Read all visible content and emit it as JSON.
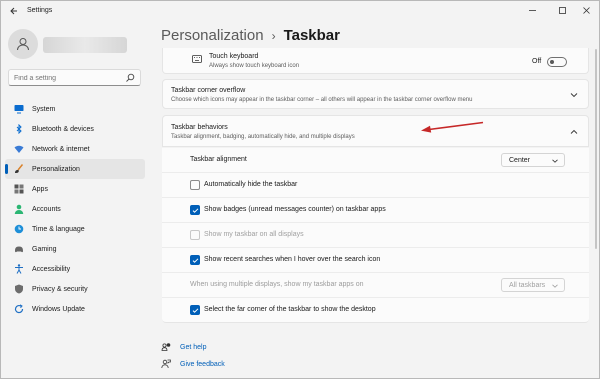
{
  "window": {
    "title": "Settings"
  },
  "sidebar": {
    "search_placeholder": "Find a setting",
    "items": [
      {
        "label": "System",
        "icon": "monitor-icon"
      },
      {
        "label": "Bluetooth & devices",
        "icon": "bluetooth-icon"
      },
      {
        "label": "Network & internet",
        "icon": "wifi-icon"
      },
      {
        "label": "Personalization",
        "icon": "brush-icon",
        "active": true
      },
      {
        "label": "Apps",
        "icon": "apps-icon"
      },
      {
        "label": "Accounts",
        "icon": "person-icon"
      },
      {
        "label": "Time & language",
        "icon": "globe-clock-icon"
      },
      {
        "label": "Gaming",
        "icon": "gamepad-icon"
      },
      {
        "label": "Accessibility",
        "icon": "accessibility-icon"
      },
      {
        "label": "Privacy & security",
        "icon": "shield-icon"
      },
      {
        "label": "Windows Update",
        "icon": "update-icon"
      }
    ]
  },
  "header": {
    "parent": "Personalization",
    "separator": "›",
    "current": "Taskbar"
  },
  "touch_keyboard": {
    "title": "Touch keyboard",
    "subtitle": "Always show touch keyboard icon",
    "state": "Off"
  },
  "corner_overflow": {
    "title": "Taskbar corner overflow",
    "subtitle": "Choose which icons may appear in the taskbar corner – all others will appear in the taskbar corner overflow menu"
  },
  "behaviors": {
    "title": "Taskbar behaviors",
    "subtitle": "Taskbar alignment, badging, automatically hide, and multiple displays",
    "alignment_label": "Taskbar alignment",
    "alignment_value": "Center",
    "options": [
      {
        "label": "Automatically hide the taskbar",
        "checked": false,
        "disabled": false
      },
      {
        "label": "Show badges (unread messages counter) on taskbar apps",
        "checked": true,
        "disabled": false
      },
      {
        "label": "Show my taskbar on all displays",
        "checked": false,
        "disabled": true
      },
      {
        "label": "Show recent searches when I hover over the search icon",
        "checked": true,
        "disabled": false
      }
    ],
    "multi_display_label": "When using multiple displays, show my taskbar apps on",
    "multi_display_value": "All taskbars",
    "far_corner_label": "Select the far corner of the taskbar to show the desktop",
    "far_corner_checked": true
  },
  "footer": {
    "help": "Get help",
    "feedback": "Give feedback"
  },
  "colors": {
    "accent": "#005fb8",
    "annotation_arrow": "#c62828"
  }
}
